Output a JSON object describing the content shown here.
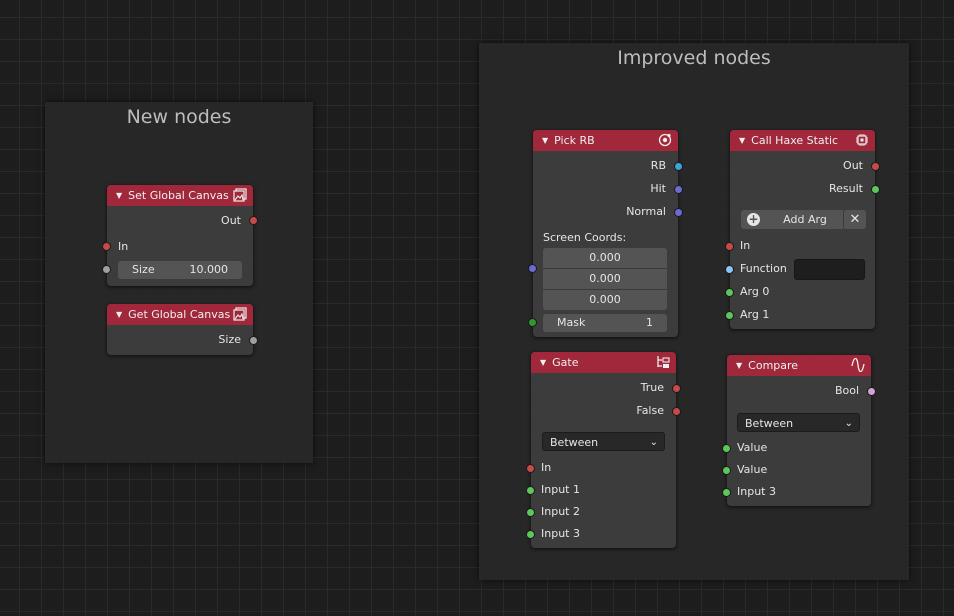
{
  "colors": {
    "header": "#a0283a",
    "socket_red": "#c74a4a",
    "socket_gray": "#a0a0a0",
    "socket_blue": "#3ea4d9",
    "socket_purple": "#6b6bd1",
    "socket_green": "#5cc85c",
    "socket_lightblue": "#8cc5f5",
    "socket_pink": "#d6a0d6"
  },
  "frames": {
    "new_nodes": "New nodes",
    "improved_nodes": "Improved nodes"
  },
  "set_global_canvas": {
    "title": "Set Global Canvas ...",
    "out": "Out",
    "in": "In",
    "size_label": "Size",
    "size_value": "10.000",
    "icon": "image-icon"
  },
  "get_global_canvas": {
    "title": "Get Global Canvas ...",
    "size": "Size",
    "icon": "image-icon"
  },
  "pick_rb": {
    "title": "Pick RB",
    "outputs": [
      "RB",
      "Hit",
      "Normal"
    ],
    "screen_coords_label": "Screen Coords:",
    "coords": [
      "0.000",
      "0.000",
      "0.000"
    ],
    "mask_label": "Mask",
    "mask_value": "1",
    "icon": "target-icon"
  },
  "call_haxe_static": {
    "title": "Call Haxe Static",
    "outputs": [
      "Out",
      "Result"
    ],
    "add_arg": "Add Arg",
    "inputs": [
      "In",
      "Function",
      "Arg 0",
      "Arg 1"
    ],
    "icon": "chip-icon"
  },
  "gate": {
    "title": "Gate",
    "outputs": [
      "True",
      "False"
    ],
    "select": "Between",
    "inputs": [
      "In",
      "Input 1",
      "Input 2",
      "Input 3"
    ],
    "icon": "tree-icon"
  },
  "compare": {
    "title": "Compare",
    "output": "Bool",
    "select": "Between",
    "inputs": [
      "Value",
      "Value",
      "Input 3"
    ],
    "icon": "wave-icon"
  }
}
